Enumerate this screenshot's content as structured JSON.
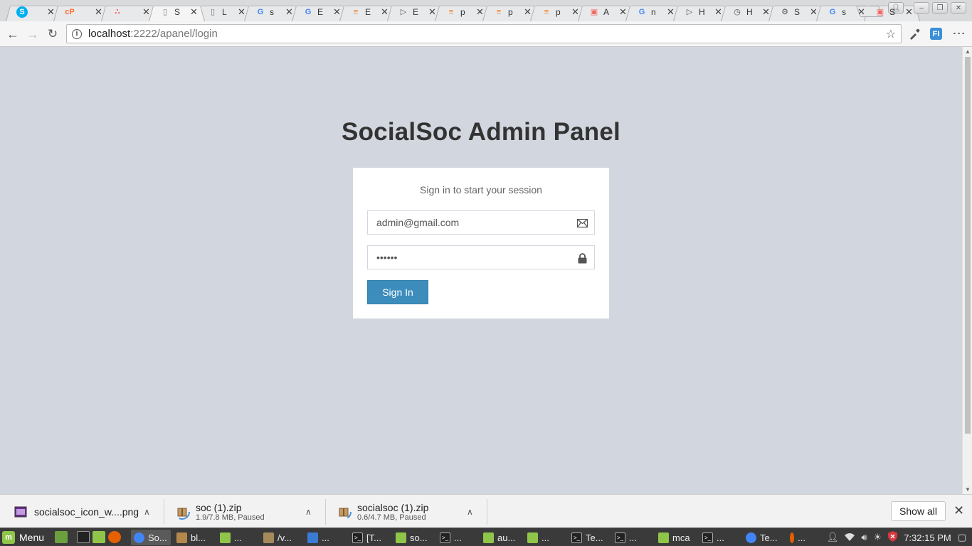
{
  "browser": {
    "tabs": [
      {
        "favicon": "skype-icon",
        "title": "",
        "color": "#00aff0"
      },
      {
        "favicon": "cpanel-icon",
        "title": "",
        "color": "#ff6c2c"
      },
      {
        "favicon": "asana-icon",
        "title": "",
        "color": "#f06a6a"
      },
      {
        "favicon": "page-icon",
        "title": "S",
        "color": "#777777",
        "active": true
      },
      {
        "favicon": "page-icon",
        "title": "L",
        "color": "#777777"
      },
      {
        "favicon": "google-icon",
        "title": "s",
        "color": "#4285f4"
      },
      {
        "favicon": "google-icon",
        "title": "E",
        "color": "#4285f4"
      },
      {
        "favicon": "stackoverflow-icon",
        "title": "E",
        "color": "#f48024"
      },
      {
        "favicon": "play-icon",
        "title": "E",
        "color": "#555555"
      },
      {
        "favicon": "stackoverflow-icon",
        "title": "p",
        "color": "#f48024"
      },
      {
        "favicon": "stackoverflow-icon",
        "title": "p",
        "color": "#f48024"
      },
      {
        "favicon": "stackoverflow-icon",
        "title": "p",
        "color": "#f48024"
      },
      {
        "favicon": "laravel-icon",
        "title": "A",
        "color": "#f4645f"
      },
      {
        "favicon": "google-icon",
        "title": "n",
        "color": "#4285f4"
      },
      {
        "favicon": "play-icon",
        "title": "H",
        "color": "#555555"
      },
      {
        "favicon": "history-icon",
        "title": "H",
        "color": "#555555"
      },
      {
        "favicon": "gear-icon",
        "title": "S",
        "color": "#555555"
      },
      {
        "favicon": "google-icon",
        "title": "s",
        "color": "#4285f4"
      },
      {
        "favicon": "laravel-icon",
        "title": "S",
        "color": "#f4645f"
      }
    ],
    "url_host": "localhost",
    "url_rest": ":2222/apanel/login"
  },
  "page": {
    "logo": "SocialSoc Admin Panel",
    "login_msg": "Sign in to start your session",
    "email_value": "admin@gmail.com",
    "password_value": "••••••",
    "signin_label": "Sign In",
    "accent": "#3c8dbc",
    "background": "#d2d6de"
  },
  "downloads": {
    "items": [
      {
        "name": "socialsoc_icon_w....png",
        "sub": "",
        "icon": "image-file-icon"
      },
      {
        "name": "soc (1).zip",
        "sub": "1.9/7.8 MB, Paused",
        "icon": "archive-icon"
      },
      {
        "name": "socialsoc (1).zip",
        "sub": "0.6/4.7 MB, Paused",
        "icon": "archive-icon"
      }
    ],
    "show_all": "Show all"
  },
  "taskbar": {
    "menu_label": "Menu",
    "tasks": [
      {
        "label": "So...",
        "icon": "chrome-icon",
        "color": "#4285f4",
        "active": true
      },
      {
        "label": "bl...",
        "icon": "archive-icon",
        "color": "#b5874b"
      },
      {
        "label": "...",
        "icon": "folder-icon",
        "color": "#8fc649"
      },
      {
        "label": "/v...",
        "icon": "editor-icon",
        "color": "#a58b5c"
      },
      {
        "label": "...",
        "icon": "vscode-icon",
        "color": "#3a7bd5"
      },
      {
        "label": "[T...",
        "icon": "terminal-icon",
        "color": "#222222"
      },
      {
        "label": "so...",
        "icon": "folder-icon",
        "color": "#8fc649"
      },
      {
        "label": "...",
        "icon": "terminal-icon",
        "color": "#222222"
      },
      {
        "label": "au...",
        "icon": "folder-icon",
        "color": "#8fc649"
      },
      {
        "label": "...",
        "icon": "folder-icon",
        "color": "#8fc649"
      },
      {
        "label": "Te...",
        "icon": "terminal-icon",
        "color": "#222222"
      },
      {
        "label": "...",
        "icon": "terminal-icon",
        "color": "#222222"
      },
      {
        "label": "mca",
        "icon": "folder-icon",
        "color": "#8fc649"
      },
      {
        "label": "...",
        "icon": "terminal-icon",
        "color": "#222222"
      },
      {
        "label": "Te...",
        "icon": "chrome-icon",
        "color": "#4285f4"
      },
      {
        "label": "...",
        "icon": "firefox-icon",
        "color": "#e66000"
      }
    ],
    "clock": "7:32:15 PM"
  }
}
